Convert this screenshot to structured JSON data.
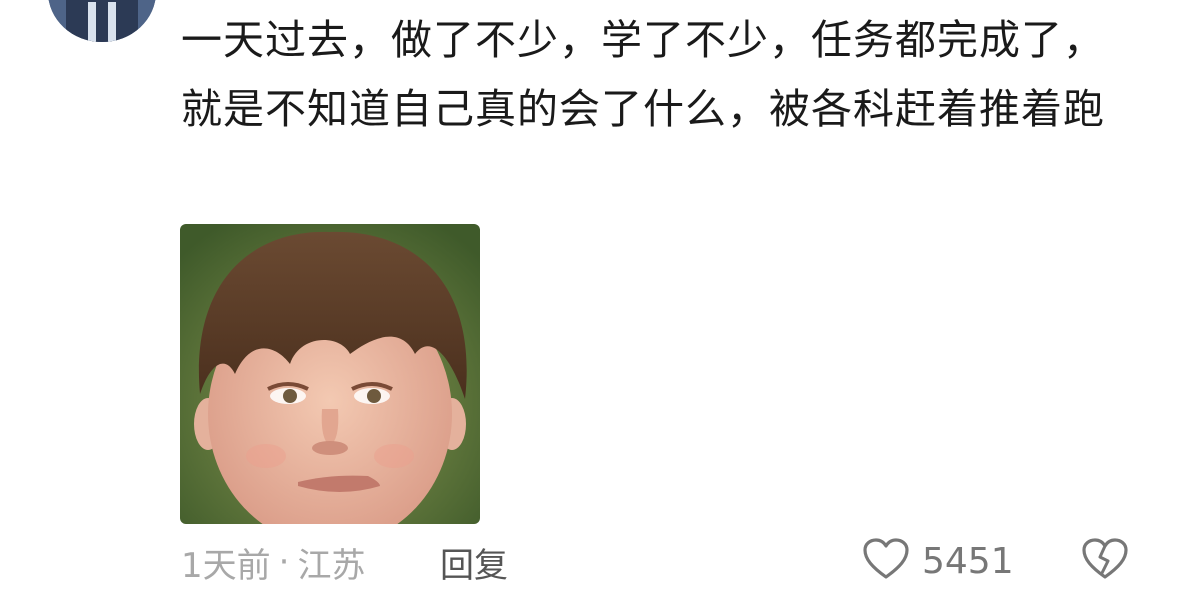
{
  "comment": {
    "text": "一天过去，做了不少，学了不少，任务都完成了，就是不知道自己真的会了什么，被各科赶着推着跑",
    "time": "1天前",
    "separator": "·",
    "location": "江苏",
    "reply_label": "回复",
    "like_count": "5451",
    "like_icon": "heart-outline-icon",
    "dislike_icon": "broken-heart-icon",
    "sticker": "boy-smirk-sticker"
  }
}
